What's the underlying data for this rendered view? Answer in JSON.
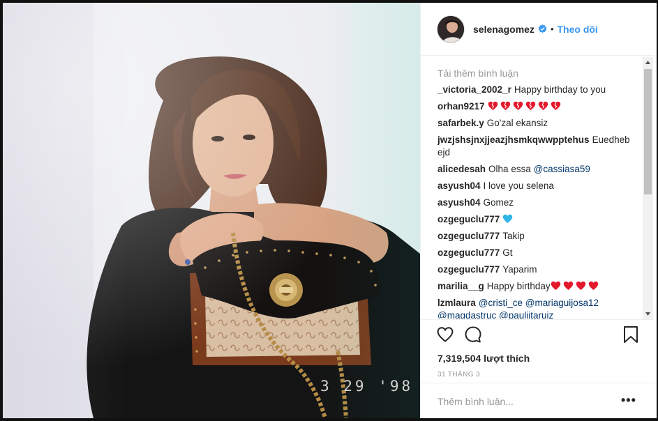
{
  "post": {
    "username": "selenagomez",
    "follow_label": "Theo dõi",
    "dot": "•",
    "photo_datestamp": "3 29 '98"
  },
  "comments": {
    "load_more": "Tải thêm bình luận",
    "items": [
      {
        "user": "_victoria_2002_r",
        "text": "Happy birthday to you",
        "hearts": 0
      },
      {
        "user": "orhan9217",
        "text": "",
        "hearts": 6,
        "heart_style": "broken"
      },
      {
        "user": "safarbek.y",
        "text": "Go'zal ekansiz",
        "hearts": 0
      },
      {
        "user": "jwzjshsjnxjjeazjhsmkqwwpptehus",
        "text": "Euedheb ejd",
        "hearts": 0
      },
      {
        "user": "alicedesah",
        "text": "Olha essa",
        "mention": "@cassiasa59",
        "hearts": 0
      },
      {
        "user": "asyush04",
        "text": "I love you selena",
        "hearts": 0
      },
      {
        "user": "asyush04",
        "text": "Gomez",
        "hearts": 0
      },
      {
        "user": "ozgeguclu777",
        "text": "",
        "hearts": 1,
        "heart_style": "blue"
      },
      {
        "user": "ozgeguclu777",
        "text": "Takip",
        "hearts": 0
      },
      {
        "user": "ozgeguclu777",
        "text": "Gt",
        "hearts": 0
      },
      {
        "user": "ozgeguclu777",
        "text": "Yaparim",
        "hearts": 0
      },
      {
        "user": "marilia__g",
        "text": "Happy birthday",
        "hearts": 4,
        "heart_style": "red"
      },
      {
        "user": "lzmlaura",
        "text": "",
        "mentions": [
          "@cristi_ce",
          "@mariaguijosa12",
          "@magdastruc",
          "@paulijtaruiz"
        ],
        "hearts": 0
      }
    ]
  },
  "actions": {
    "likes": "7,319,504 lượt thích",
    "date": "31 THÁNG 3"
  },
  "add_comment": {
    "placeholder": "Thêm bình luận...",
    "more": "•••"
  },
  "colors": {
    "accent": "#3897f0",
    "mention": "#003569",
    "heart_red": "#e3192c",
    "heart_blue": "#2fb6e8"
  },
  "icons": [
    "verified-badge-icon",
    "heart-icon",
    "comment-icon",
    "bookmark-icon",
    "more-icon",
    "scroll-up-icon",
    "scroll-down-icon"
  ]
}
